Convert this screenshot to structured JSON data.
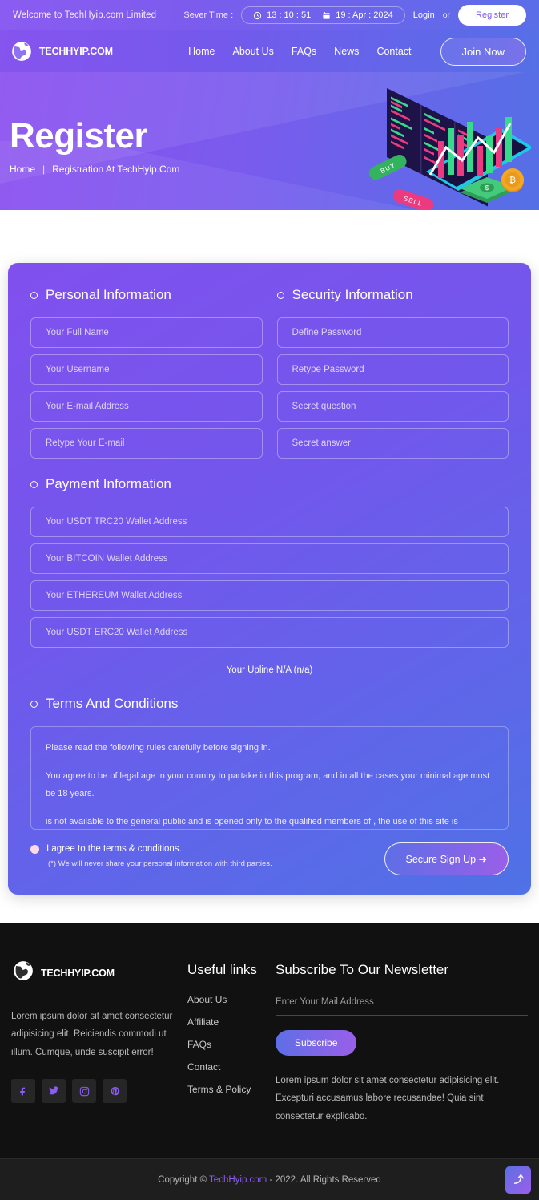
{
  "topbar": {
    "welcome": "Welcome to TechHyip.com Limited",
    "server_label": "Sever Time :",
    "time": "13 : 10 : 51",
    "date": "19 : Apr : 2024",
    "login": "Login",
    "or": "or",
    "register": "Register"
  },
  "navbar": {
    "brand": "TECHHYIP.COM",
    "links": [
      {
        "label": "Home"
      },
      {
        "label": "About Us"
      },
      {
        "label": "FAQs"
      },
      {
        "label": "News"
      },
      {
        "label": "Contact"
      }
    ],
    "join": "Join Now"
  },
  "hero": {
    "title": "Register",
    "crumb_home": "Home",
    "crumb_sep": "|",
    "crumb_current": "Registration At TechHyip.Com"
  },
  "form": {
    "personal": {
      "heading": "Personal Information",
      "fields": [
        {
          "placeholder": "Your Full Name"
        },
        {
          "placeholder": "Your Username"
        },
        {
          "placeholder": "Your E-mail Address"
        },
        {
          "placeholder": "Retype Your E-mail"
        }
      ]
    },
    "security": {
      "heading": "Security Information",
      "fields": [
        {
          "placeholder": "Define Password"
        },
        {
          "placeholder": "Retype Password"
        },
        {
          "placeholder": "Secret question"
        },
        {
          "placeholder": "Secret answer"
        }
      ]
    },
    "payment": {
      "heading": "Payment Information",
      "fields": [
        {
          "placeholder": "Your USDT TRC20 Wallet Address"
        },
        {
          "placeholder": "Your BITCOIN Wallet Address"
        },
        {
          "placeholder": "Your ETHEREUM Wallet Address"
        },
        {
          "placeholder": "Your USDT ERC20 Wallet Address"
        }
      ]
    },
    "upline": "Your Upline N/A (n/a)",
    "terms": {
      "heading": "Terms And Conditions",
      "paragraphs": [
        "Please read the following rules carefully before signing in.",
        "You agree to be of legal age in your country to partake in this program, and in all the cases your minimal age must be 18 years.",
        "is not available to the general public and is opened only to the qualified members of , the use of this site is restricted to our"
      ]
    },
    "agree_label": "I agree to the terms & conditions.",
    "agree_note": "(*) We will never share your personal information with third parties.",
    "signup": "Secure Sign Up ➜"
  },
  "footer": {
    "brand": "TECHHYIP.COM",
    "description": "Lorem ipsum dolor sit amet consectetur adipisicing elit. Reiciendis commodi ut illum. Cumque, unde suscipit error!",
    "socials": [
      {
        "name": "facebook",
        "glyph": "f"
      },
      {
        "name": "twitter",
        "glyph": "t"
      },
      {
        "name": "instagram",
        "glyph": "i"
      },
      {
        "name": "pinterest",
        "glyph": "p"
      }
    ],
    "links_title": "Useful links",
    "links": [
      {
        "label": "About Us"
      },
      {
        "label": "Affiliate"
      },
      {
        "label": "FAQs"
      },
      {
        "label": "Contact"
      },
      {
        "label": "Terms & Policy"
      }
    ],
    "newsletter_title": "Subscribe To Our Newsletter",
    "newsletter_placeholder": "Enter Your Mail Address",
    "subscribe": "Subscribe",
    "newsletter_desc": "Lorem ipsum dolor sit amet consectetur adipisicing elit. Excepturi accusamus labore recusandae! Quia sint consectetur explicabo.",
    "copyright_prefix": "Copyright © ",
    "copyright_link": "TechHyip.com",
    "copyright_suffix": " - 2022. All Rights Reserved"
  },
  "colors": {
    "accent_purple": "#8b5cf1",
    "accent_blue": "#5570e7",
    "footer_bg": "#111111",
    "copyright_bg": "#1e1e1e"
  }
}
